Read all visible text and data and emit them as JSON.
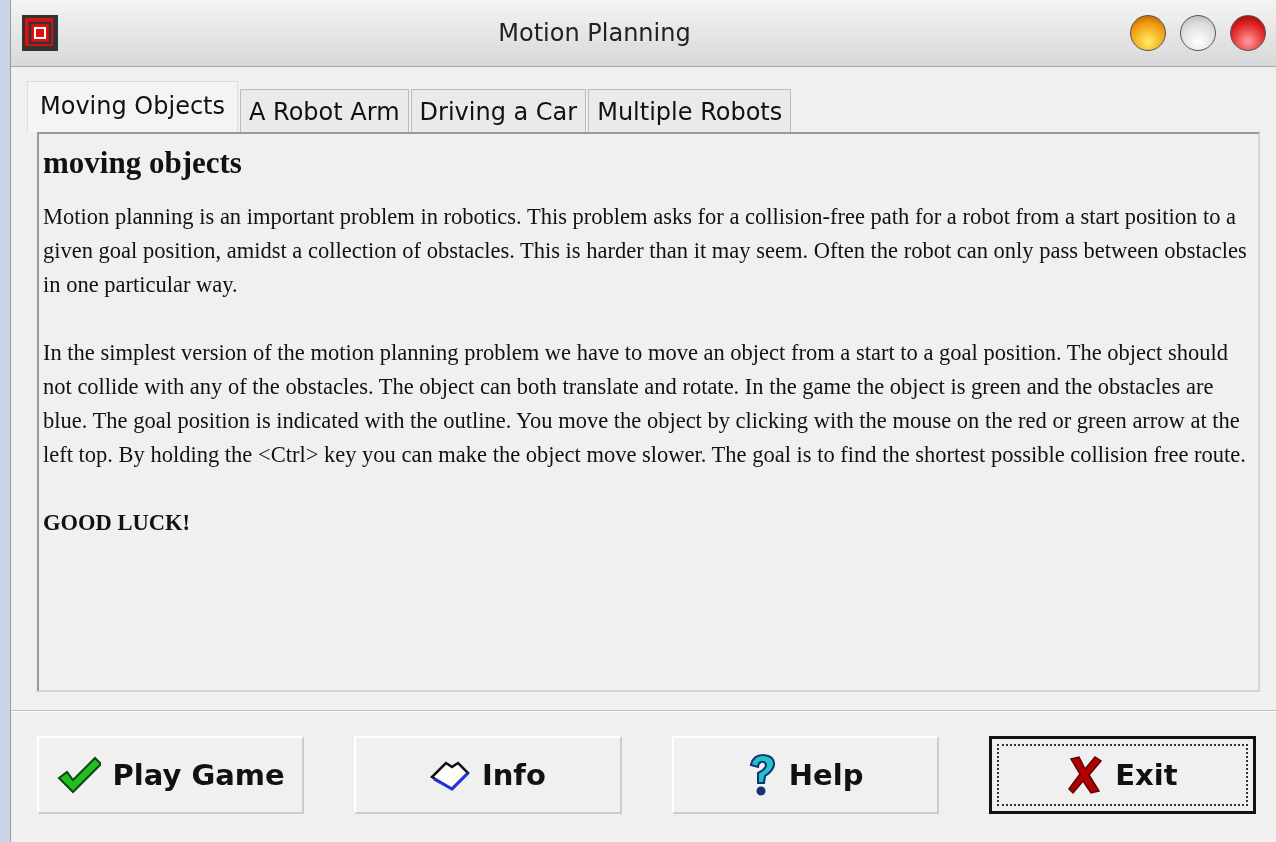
{
  "window": {
    "title": "Motion Planning"
  },
  "tabs": [
    {
      "label": "Moving Objects",
      "selected": true
    },
    {
      "label": "A Robot Arm",
      "selected": false
    },
    {
      "label": "Driving a Car",
      "selected": false
    },
    {
      "label": "Multiple Robots",
      "selected": false
    }
  ],
  "content": {
    "heading": "moving objects",
    "paragraphs": [
      "Motion planning is an important problem in robotics. This problem asks for a collision-free path for a robot from a start position to a given goal position, amidst a collection of obstacles. This is harder than it may seem. Often the robot can only pass between obstacles in one particular way.",
      "In the simplest version of the motion planning problem we have to move an object from a start to a goal position. The object should not collide with any of the obstacles. The object can both translate and rotate. In the game the object is green and the obstacles are blue. The goal position is indicated with the outline. You move the object by clicking with the mouse on the red or green arrow at the left top. By holding the <Ctrl> key you can make the object move slower. The goal is to find the shortest possible collision free route."
    ],
    "closing": "GOOD LUCK!"
  },
  "buttons": [
    {
      "label": "Play Game",
      "kind": "check",
      "focused": false
    },
    {
      "label": "Info",
      "kind": "book",
      "focused": false
    },
    {
      "label": "Help",
      "kind": "question",
      "focused": false
    },
    {
      "label": "Exit",
      "kind": "cross",
      "focused": true
    }
  ]
}
